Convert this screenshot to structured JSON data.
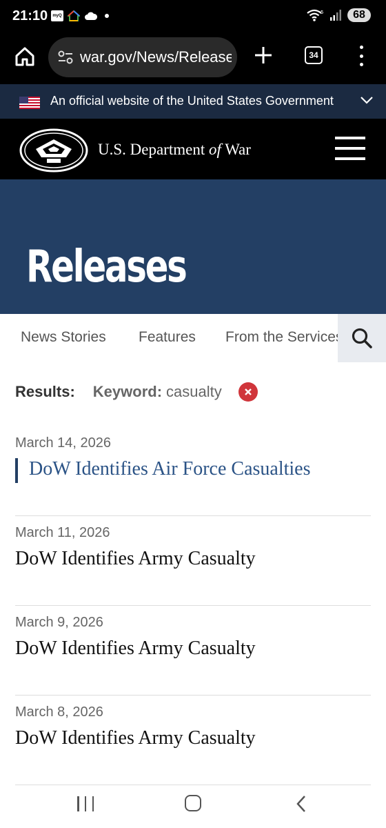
{
  "status_bar": {
    "time": "21:10",
    "myq_label": "myQ",
    "battery": "68",
    "wifi_badge": "5"
  },
  "browser": {
    "url": "war.gov/News/Releases",
    "tab_count": "34"
  },
  "gov_banner": {
    "text": "An official website of the United States Government"
  },
  "site": {
    "title_pre": "U.S. Department ",
    "title_of": "of",
    "title_post": " War"
  },
  "hero": {
    "title": "Releases"
  },
  "tabs": [
    {
      "label": "News Stories"
    },
    {
      "label": "Features"
    },
    {
      "label": "From the Services"
    }
  ],
  "filter": {
    "results_label": "Results:",
    "keyword_label": "Keyword:",
    "keyword_value": "casualty"
  },
  "releases": [
    {
      "date": "March 14, 2026",
      "title": "DoW Identifies Air Force Casualties"
    },
    {
      "date": "March 11, 2026",
      "title": "DoW Identifies Army Casualty"
    },
    {
      "date": "March 9, 2026",
      "title": "DoW Identifies Army Casualty"
    },
    {
      "date": "March 8, 2026",
      "title": "DoW Identifies Army Casualty"
    }
  ],
  "colors": {
    "hero_bg": "#233f64",
    "banner_bg": "#1b2a41",
    "link_active": "#2b5386",
    "clear_button": "#d0353b"
  },
  "icons": {
    "home": "home-icon",
    "site_settings": "site-settings-icon",
    "new_tab": "plus-icon",
    "tabs": "tab-switcher-icon",
    "menu": "more-vert-icon",
    "flag": "us-flag-icon",
    "expand": "chevron-down-icon",
    "seal": "pentagon-seal-icon",
    "hamburger": "hamburger-menu-icon",
    "search": "search-icon",
    "clear": "close-icon"
  }
}
